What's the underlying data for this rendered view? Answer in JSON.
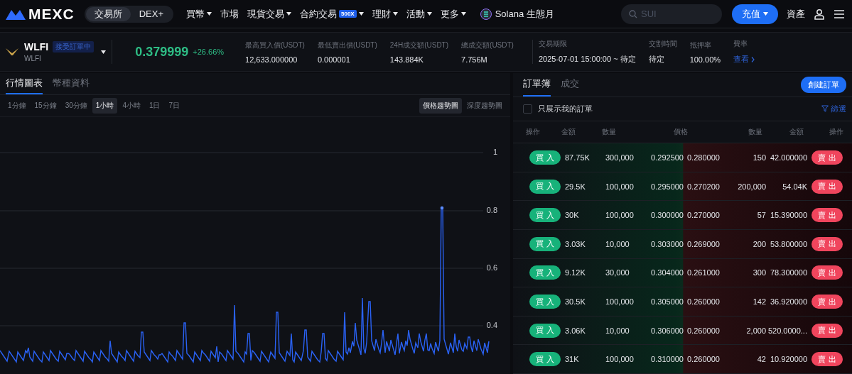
{
  "nav": {
    "logo": "MEXC",
    "segments": [
      {
        "label": "交易所",
        "selected": true
      },
      {
        "label": "DEX+",
        "selected": false
      }
    ],
    "menu": [
      {
        "label": "買幣",
        "dropdown": true
      },
      {
        "label": "市場",
        "dropdown": false
      },
      {
        "label": "現貨交易",
        "dropdown": true
      },
      {
        "label": "合約交易",
        "badge": "500X",
        "dropdown": true
      },
      {
        "label": "理財",
        "dropdown": true
      },
      {
        "label": "活動",
        "dropdown": true
      },
      {
        "label": "更多",
        "dropdown": true
      }
    ],
    "promo": "Solana 生態月",
    "search": {
      "placeholder": "SUI"
    },
    "deposit": "充值",
    "assets": "資產"
  },
  "ticker": {
    "symbol": "WLFI",
    "status": "接受訂單中",
    "sub": "WLFI",
    "price": "0.379999",
    "change": "+26.66%",
    "stats": [
      {
        "label": "最高買入價(USDT)",
        "value": "12,633.000000"
      },
      {
        "label": "最低賣出價(USDT)",
        "value": "0.000001"
      },
      {
        "label": "24H成交額(USDT)",
        "value": "143.884K"
      },
      {
        "label": "總成交額(USDT)",
        "value": "7.756M"
      },
      {
        "label": "交易期限",
        "value": "2025-07-01 15:00:00 ~ 待定"
      },
      {
        "label": "交割時間",
        "value": "待定"
      },
      {
        "label": "抵押率",
        "value": "100.00%"
      }
    ],
    "fee": {
      "label": "費率",
      "link": "查看"
    }
  },
  "chart_panel": {
    "tabs": [
      {
        "label": "行情圖表",
        "selected": true
      },
      {
        "label": "幣種資料",
        "selected": false
      }
    ],
    "intervals": [
      {
        "label": "1分鐘",
        "selected": false
      },
      {
        "label": "15分鐘",
        "selected": false
      },
      {
        "label": "30分鐘",
        "selected": false
      },
      {
        "label": "1小時",
        "selected": true
      },
      {
        "label": "4小時",
        "selected": false
      },
      {
        "label": "1日",
        "selected": false
      },
      {
        "label": "7日",
        "selected": false
      }
    ],
    "views": [
      {
        "label": "價格趨勢圖",
        "selected": true
      },
      {
        "label": "深度趨勢圖",
        "selected": false
      }
    ],
    "y_axis_labels": [
      "1",
      "0.8",
      "0.6",
      "0.4"
    ]
  },
  "order_book": {
    "tabs": [
      {
        "label": "訂單簿",
        "selected": true
      },
      {
        "label": "成交",
        "selected": false
      }
    ],
    "create_button": "創建訂單",
    "only_mine": {
      "label": "只展示我的訂單",
      "checked": false
    },
    "filter": "篩選",
    "columns": [
      "操作",
      "金額",
      "數量",
      "價格",
      "數量",
      "金額",
      "操作"
    ],
    "rows": [
      {
        "buy": "買入",
        "buy_amount": "87.75K",
        "buy_qty": "300,000",
        "buy_price": "0.292500",
        "sell_price": "0.280000",
        "sell_qty": "150",
        "sell_amount": "42.000000",
        "sell": "賣出"
      },
      {
        "buy": "買入",
        "buy_amount": "29.5K",
        "buy_qty": "100,000",
        "buy_price": "0.295000",
        "sell_price": "0.270200",
        "sell_qty": "200,000",
        "sell_amount": "54.04K",
        "sell": "賣出"
      },
      {
        "buy": "買入",
        "buy_amount": "30K",
        "buy_qty": "100,000",
        "buy_price": "0.300000",
        "sell_price": "0.270000",
        "sell_qty": "57",
        "sell_amount": "15.390000",
        "sell": "賣出"
      },
      {
        "buy": "買入",
        "buy_amount": "3.03K",
        "buy_qty": "10,000",
        "buy_price": "0.303000",
        "sell_price": "0.269000",
        "sell_qty": "200",
        "sell_amount": "53.800000",
        "sell": "賣出"
      },
      {
        "buy": "買入",
        "buy_amount": "9.12K",
        "buy_qty": "30,000",
        "buy_price": "0.304000",
        "sell_price": "0.261000",
        "sell_qty": "300",
        "sell_amount": "78.300000",
        "sell": "賣出"
      },
      {
        "buy": "買入",
        "buy_amount": "30.5K",
        "buy_qty": "100,000",
        "buy_price": "0.305000",
        "sell_price": "0.260000",
        "sell_qty": "142",
        "sell_amount": "36.920000",
        "sell": "賣出"
      },
      {
        "buy": "買入",
        "buy_amount": "3.06K",
        "buy_qty": "10,000",
        "buy_price": "0.306000",
        "sell_price": "0.260000",
        "sell_qty": "2,000",
        "sell_amount": "520.0000...",
        "sell": "賣出"
      },
      {
        "buy": "買入",
        "buy_amount": "31K",
        "buy_qty": "100,000",
        "buy_price": "0.310000",
        "sell_price": "0.260000",
        "sell_qty": "42",
        "sell_amount": "10.920000",
        "sell": "賣出"
      }
    ]
  }
}
